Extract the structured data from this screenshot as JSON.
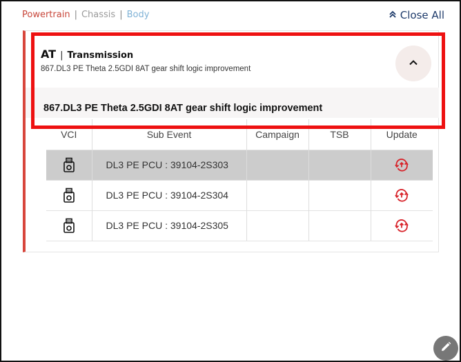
{
  "nav": {
    "items": [
      "Powertrain",
      "Chassis",
      "Body"
    ],
    "separator": "|",
    "close_all": "Close All"
  },
  "card": {
    "code": "AT",
    "bar": "|",
    "subtitle": "Transmission",
    "description": "867.DL3 PE Theta 2.5GDI 8AT gear shift logic improvement",
    "banner": "867.DL3 PE Theta 2.5GDI 8AT gear shift logic improvement"
  },
  "table": {
    "columns": [
      "VCI",
      "Sub Event",
      "Campaign",
      "TSB",
      "Update"
    ],
    "rows": [
      {
        "sub_event": "DL3 PE PCU : 39104-2S303",
        "campaign": "",
        "tsb": "",
        "selected": true
      },
      {
        "sub_event": "DL3 PE PCU : 39104-2S304",
        "campaign": "",
        "tsb": "",
        "selected": false
      },
      {
        "sub_event": "DL3 PE PCU : 39104-2S305",
        "campaign": "",
        "tsb": "",
        "selected": false
      }
    ]
  },
  "colors": {
    "accent_red": "#d8463c",
    "update_icon": "#d8232a",
    "highlight": "#ee1111",
    "selected_row": "#cccccc"
  },
  "icons": {
    "close_all": "double-chevron-up-icon",
    "toggle": "chevron-up-icon",
    "vci": "vci-device-icon",
    "update": "cloud-update-icon",
    "fab": "pencil-icon"
  }
}
